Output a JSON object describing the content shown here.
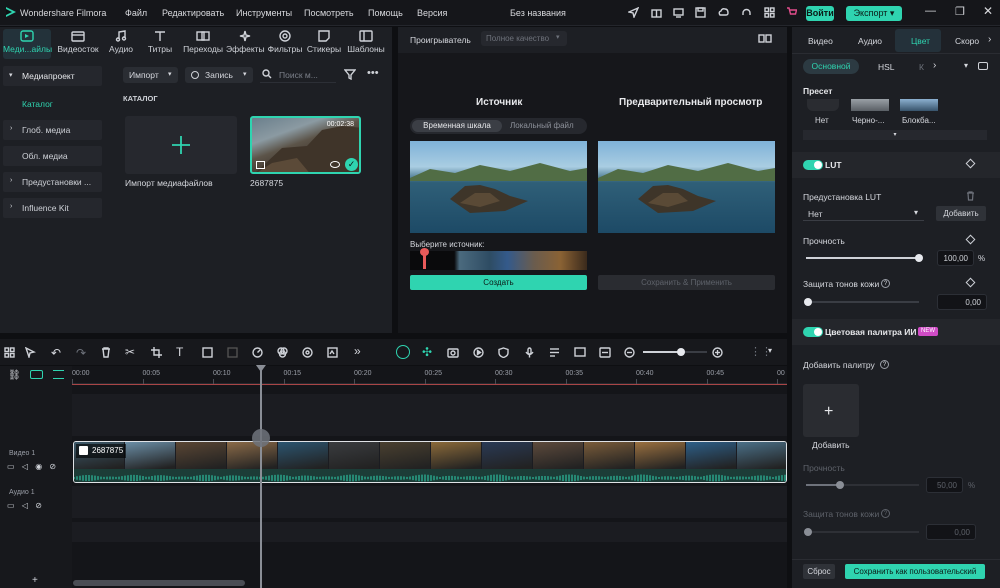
{
  "app": {
    "name": "Wondershare Filmora",
    "project_title": "Без названия"
  },
  "menu": [
    "Файл",
    "Редактировать",
    "Инструменты",
    "Посмотреть",
    "Помощь",
    "Версия"
  ],
  "titlebar": {
    "login": "Войти",
    "export": "Экспорт"
  },
  "media_nav": [
    "Меди...айлы",
    "Видеосток",
    "Аудио",
    "Титры",
    "Переходы",
    "Эффекты",
    "Фильтры",
    "Стикеры",
    "Шаблоны"
  ],
  "sidebar": {
    "items": [
      "Медиапроект",
      "Каталог",
      "Глоб. медиа",
      "Обл. медиа",
      "Предустановки ...",
      "Influence Kit"
    ]
  },
  "media_toolbar": {
    "import": "Импорт",
    "record": "Запись",
    "search_placeholder": "Поиск м..."
  },
  "catalog": {
    "heading": "КАТАЛОГ",
    "import_label": "Импорт медиафайлов",
    "clip_name": "2687875",
    "clip_duration": "00:02:38"
  },
  "player": {
    "label": "Проигрыватель",
    "quality": "Полное качество",
    "source_title": "Источник",
    "preview_title": "Предварительный просмотр",
    "tab_timeline": "Временная шкала",
    "tab_local": "Локальный файл",
    "choose_source": "Выберите источник:",
    "create_btn": "Создать",
    "save_apply_btn": "Сохранить & Применить"
  },
  "timeline": {
    "ruler": [
      "00:00",
      "00:05",
      "00:10",
      "00:15",
      "00:20",
      "00:25",
      "00:30",
      "00:35",
      "00:40",
      "00:45",
      "00"
    ],
    "video_track": "Видео 1",
    "audio_track": "Аудио 1",
    "clip_name": "2687875",
    "playhead_fraction": 0.095,
    "zoom_fraction": 0.6
  },
  "right_panel": {
    "tabs": [
      "Видео",
      "Аудио",
      "Цвет",
      "Скоро"
    ],
    "subtabs": [
      "Основной",
      "HSL",
      "К"
    ],
    "preset_title": "Пресет",
    "presets": [
      "Нет",
      "Черно-...",
      "Блокба..."
    ],
    "lut_title": "LUT",
    "lut_preset_label": "Предустановка LUT",
    "lut_value": "Нет",
    "add_btn": "Добавить",
    "strength_label": "Прочность",
    "strength_value": "100,00",
    "strength_unit": "%",
    "strength_fraction": 1.0,
    "skin_label": "Защита тонов кожи",
    "skin_value": "0,00",
    "ai_palette_title": "Цветовая палитра ИИ",
    "new_badge": "NEW",
    "add_palette_label": "Добавить палитру",
    "add_palette_btn": "Добавить",
    "strength2_value": "50,00",
    "strength2_unit": "%",
    "strength2_fraction": 0.3,
    "skin2_value": "0,00",
    "reset_btn": "Сброс",
    "save_custom_btn": "Сохранить как пользовательский"
  },
  "colors": {
    "accent": "#2fd4b0",
    "new_badge": "#d04cc6",
    "playhead_red": "#e85a5a"
  }
}
